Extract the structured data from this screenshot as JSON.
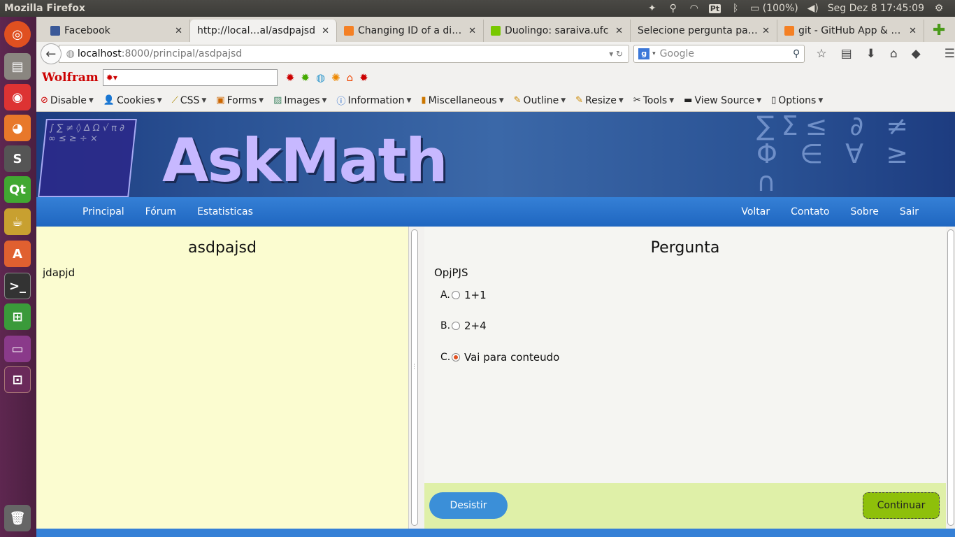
{
  "os": {
    "window_title": "Mozilla Firefox",
    "battery": "(100%)",
    "clock": "Seg Dez  8 17:45:09",
    "lang": "Pt"
  },
  "tabs": [
    {
      "label": "Facebook",
      "color": "#3b5998"
    },
    {
      "label": "http://local…al/asdpajsd",
      "color": ""
    },
    {
      "label": "Changing ID of a div …",
      "color": "#f48024"
    },
    {
      "label": "Duolingo: saraiva.ufc",
      "color": "#78c800"
    },
    {
      "label": "Selecione pergunta par…",
      "color": ""
    },
    {
      "label": "git - GitHub App & H…",
      "color": "#f48024"
    }
  ],
  "nav": {
    "url_host": "localhost",
    "url_path": ":8000/principal/asdpajsd",
    "search_placeholder": "Google"
  },
  "wolfram": {
    "brand": "Wolfram"
  },
  "devbar": {
    "items": [
      "Disable",
      "Cookies",
      "CSS",
      "Forms",
      "Images",
      "Information",
      "Miscellaneous",
      "Outline",
      "Resize",
      "Tools",
      "View Source",
      "Options"
    ]
  },
  "site": {
    "logo": "AskMath",
    "menu_left": [
      "Principal",
      "Fórum",
      "Estatisticas"
    ],
    "menu_right": [
      "Voltar",
      "Contato",
      "Sobre",
      "Sair"
    ]
  },
  "left_panel": {
    "title": "asdpajsd",
    "body": "jdapjd"
  },
  "question": {
    "heading": "Pergunta",
    "text": "OpjPJS",
    "options": [
      {
        "letter": "A.",
        "label": "1+1",
        "selected": false
      },
      {
        "letter": "B.",
        "label": "2+4",
        "selected": false
      },
      {
        "letter": "C.",
        "label": "Vai para conteudo",
        "selected": true
      }
    ]
  },
  "footer": {
    "quit": "Desistir",
    "continue": "Continuar"
  }
}
